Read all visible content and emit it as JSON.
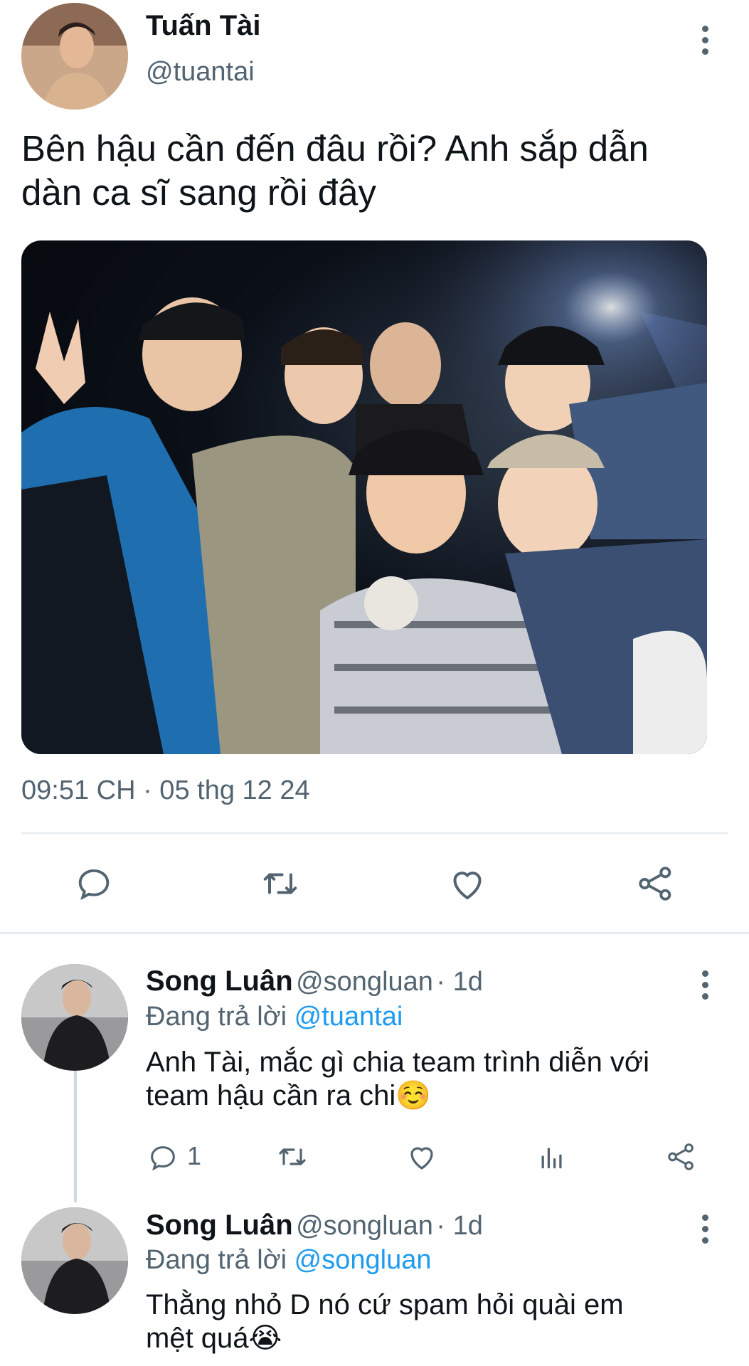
{
  "tweet": {
    "author_name": "Tuấn Tài",
    "author_handle": "@tuantai",
    "text_line1": "Bên hậu cần đến đâu rồi? Anh sắp dẫn",
    "text_line2": "dàn ca sĩ sang rồi đây",
    "timestamp": "09:51 CH · 05 thg 12 24",
    "actions": [
      "reply-icon",
      "retweet-icon",
      "like-icon",
      "share-icon"
    ]
  },
  "replies": [
    {
      "author_name": "Song Luân",
      "author_handle": "@songluan",
      "meta": "· 1d",
      "replying_prefix": "Đang trả lời",
      "replying_to": "@tuantai",
      "text_line1": "Anh Tài, mắc gì chia team trình diễn với",
      "text_line2": "team hậu cần ra chi☺️",
      "reply_count": "1",
      "actions": [
        "reply-icon",
        "retweet-icon",
        "like-icon",
        "views-icon",
        "share-icon"
      ]
    },
    {
      "author_name": "Song Luân",
      "author_handle": "@songluan",
      "meta": "· 1d",
      "replying_prefix": "Đang trả lời",
      "replying_to": "@songluan",
      "text_line1": "Thằng nhỏ D nó cứ spam hỏi quài em",
      "text_line2": "mệt quá😭"
    }
  ],
  "colors": {
    "accent": "#1d9bf0",
    "muted": "#536471",
    "text": "#0f1419"
  }
}
